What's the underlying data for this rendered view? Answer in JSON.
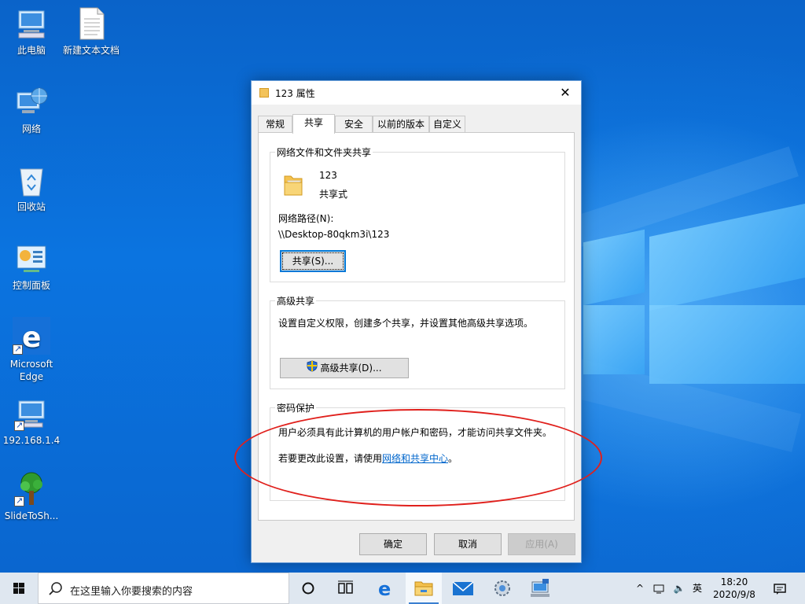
{
  "desktop": {
    "icons": [
      {
        "label": "此电脑"
      },
      {
        "label": "新建文本文档"
      },
      {
        "label": "网络"
      },
      {
        "label": "回收站"
      },
      {
        "label": "控制面板"
      },
      {
        "label": "Microsoft Edge"
      },
      {
        "label": "192.168.1.4"
      },
      {
        "label": "SlideToSh..."
      }
    ]
  },
  "dialog": {
    "title": "123 属性",
    "close_glyph": "✕",
    "tabs": [
      {
        "label": "常规"
      },
      {
        "label": "共享"
      },
      {
        "label": "安全"
      },
      {
        "label": "以前的版本"
      },
      {
        "label": "自定义"
      }
    ],
    "active_tab": "共享",
    "network_sharing": {
      "title": "网络文件和文件夹共享",
      "folder_name": "123",
      "share_state": "共享式",
      "path_label": "网络路径(N):",
      "path_value": "\\\\Desktop-80qkm3i\\123",
      "share_button": "共享(S)..."
    },
    "advanced_sharing": {
      "title": "高级共享",
      "description": "设置自定义权限，创建多个共享，并设置其他高级共享选项。",
      "button": "高级共享(D)..."
    },
    "password_protection": {
      "title": "密码保护",
      "line1": "用户必须具有此计算机的用户帐户和密码，才能访问共享文件夹。",
      "line2_prefix": "若要更改此设置，请使用",
      "line2_link": "网络和共享中心",
      "line2_suffix": "。"
    },
    "buttons": {
      "ok": "确定",
      "cancel": "取消",
      "apply": "应用(A)"
    }
  },
  "taskbar": {
    "search_placeholder": "在这里输入你要搜索的内容",
    "tray": {
      "ime": "英",
      "time": "18:20",
      "date": "2020/9/8"
    }
  },
  "colors": {
    "annotation_oval": "#e0201c",
    "link": "#0066cc",
    "accent": "#0078d7"
  }
}
